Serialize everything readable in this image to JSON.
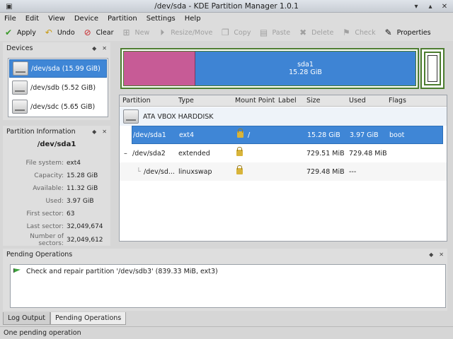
{
  "window": {
    "title": "/dev/sda - KDE Partition Manager 1.0.1"
  },
  "menu": [
    "File",
    "Edit",
    "View",
    "Device",
    "Partition",
    "Settings",
    "Help"
  ],
  "toolbar": {
    "apply": "Apply",
    "undo": "Undo",
    "clear": "Clear",
    "new": "New",
    "resize": "Resize/Move",
    "copy": "Copy",
    "paste": "Paste",
    "delete": "Delete",
    "check": "Check",
    "properties": "Properties"
  },
  "devices": {
    "title": "Devices",
    "items": [
      {
        "label": "/dev/sda (15.99 GiB)"
      },
      {
        "label": "/dev/sdb (5.52 GiB)"
      },
      {
        "label": "/dev/sdc (5.65 GiB)"
      }
    ]
  },
  "partition_info": {
    "title": "Partition Information",
    "name": "/dev/sda1",
    "rows": [
      {
        "k": "File system:",
        "v": "ext4"
      },
      {
        "k": "Capacity:",
        "v": "15.28 GiB"
      },
      {
        "k": "Available:",
        "v": "11.32 GiB"
      },
      {
        "k": "Used:",
        "v": "3.97 GiB"
      },
      {
        "k": "First sector:",
        "v": "63"
      },
      {
        "k": "Last sector:",
        "v": "32,049,674"
      },
      {
        "k": "Number of sectors:",
        "v": "32,049,612"
      }
    ]
  },
  "partbar": {
    "name": "sda1",
    "size": "15.28 GiB"
  },
  "table": {
    "headers": [
      "Partition",
      "Type",
      "Mount Point",
      "Label",
      "Size",
      "Used",
      "Flags"
    ],
    "disk": "ATA VBOX HARDDISK",
    "rows": [
      {
        "partition": "/dev/sda1",
        "type": "ext4",
        "mount": "/",
        "label": "",
        "size": "15.28 GiB",
        "used": "3.97 GiB",
        "flags": "boot"
      },
      {
        "partition": "/dev/sda2",
        "type": "extended",
        "mount": "",
        "label": "",
        "size": "729.51 MiB",
        "used": "729.48 MiB",
        "flags": ""
      },
      {
        "partition": "/dev/sd...",
        "type": "linuxswap",
        "mount": "",
        "label": "",
        "size": "729.48 MiB",
        "used": "---",
        "flags": ""
      }
    ]
  },
  "pending": {
    "title": "Pending Operations",
    "items": [
      "Check and repair partition '/dev/sdb3' (839.33 MiB, ext3)"
    ]
  },
  "tabs": [
    "Log Output",
    "Pending Operations"
  ],
  "status": "One pending operation"
}
